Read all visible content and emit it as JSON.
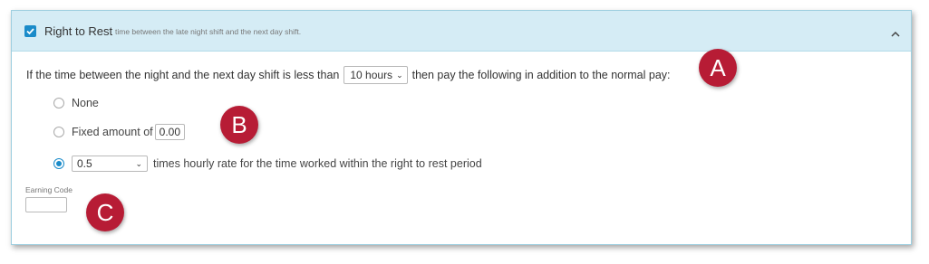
{
  "header": {
    "checkbox_checked": true,
    "title": "Right to Rest",
    "description": "time between the late night shift and the next day shift.",
    "collapse_icon": "chevron-up-icon"
  },
  "rule": {
    "prefix": "If the time between the night and the next day shift is less than",
    "hours_value": "10 hours",
    "suffix": "then pay the following in addition to the normal pay:"
  },
  "options": {
    "none_label": "None",
    "fixed_label": "Fixed amount of",
    "fixed_value": "0.00",
    "rate_value": "0.5",
    "rate_label": "times hourly rate for the time worked within the right to rest period",
    "selected": "rate"
  },
  "earning_code": {
    "label": "Earning Code",
    "value": ""
  },
  "callouts": [
    "A",
    "B",
    "C"
  ],
  "colors": {
    "accent": "#1a8bc9",
    "header_bg": "#d5ecf5",
    "callout": "#b71c35"
  }
}
